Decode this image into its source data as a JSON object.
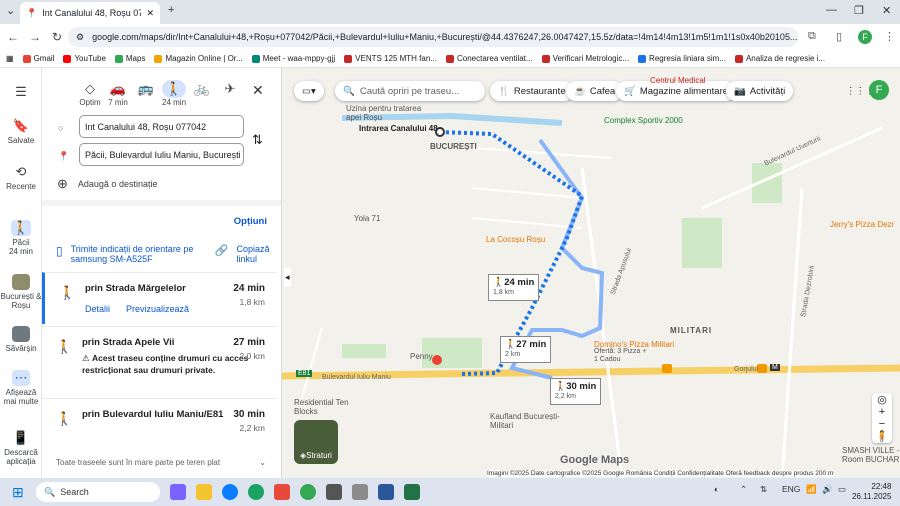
{
  "browser": {
    "tab_title": "Int Canalului 48, Roșu 077042 c",
    "new_tab": "+",
    "url": "google.com/maps/dir/Int+Canalului+48,+Roșu+077042/Păcii,+Bulevardul+Iuliu+Maniu,+București/@44.4376247,26.0047427,15.5z/data=!4m14!4m13!1m5!1m1!1s0x40b20105...",
    "profile_initial": "F",
    "bookmarks": [
      {
        "label": "Gmail",
        "color": "#ea4335"
      },
      {
        "label": "YouTube",
        "color": "#ff0000"
      },
      {
        "label": "Maps",
        "color": "#34a853"
      },
      {
        "label": "Magazin Online | Or...",
        "color": "#f4a300"
      },
      {
        "label": "Meet - waa-mppy-gjj",
        "color": "#00897b"
      },
      {
        "label": "VENTS 125 MTH fan...",
        "color": "#c62828"
      },
      {
        "label": "Conectarea ventilat...",
        "color": "#c62828"
      },
      {
        "label": "Verificari Metrologic...",
        "color": "#c62828"
      },
      {
        "label": "Regresia liniara sim...",
        "color": "#1a73e8"
      },
      {
        "label": "Analiza de regresie i...",
        "color": "#c62828"
      }
    ]
  },
  "rail": {
    "menu": "☰",
    "saved": "Salvate",
    "recent": "Recente",
    "paci": "Păcii",
    "paci_time": "24 min",
    "bucuresti": "București & Roșu",
    "savarsin": "Săvârșin",
    "more": "Afișează mai multe",
    "download": "Descarcă aplicația"
  },
  "panel": {
    "modes": [
      {
        "icon": "◇",
        "label": "Optim"
      },
      {
        "icon": "🚗",
        "label": "7 min"
      },
      {
        "icon": "🚌",
        "label": ""
      },
      {
        "icon": "🚶",
        "label": "24 min"
      },
      {
        "icon": "🚲",
        "label": ""
      },
      {
        "icon": "✈",
        "label": ""
      }
    ],
    "origin": "Int Canalului 48, Roșu 077042",
    "destination": "Păcii, Bulevardul Iuliu Maniu, București",
    "add_destination": "Adaugă o destinație",
    "options": "Opțiuni",
    "send_to_phone": "Trimite indicații de orientare pe samsung SM-A525F",
    "copy_link": "Copiază linkul",
    "routes": [
      {
        "name": "prin Strada Mărgelelor",
        "duration": "24 min",
        "distance": "1,8 km",
        "details": "Detalii",
        "preview": "Previzualizează"
      },
      {
        "name": "prin Strada Apele Vii",
        "duration": "27 min",
        "distance": "2,0 km",
        "warning": "Acest traseu conține drumuri cu acces restricționat sau drumuri private."
      },
      {
        "name": "prin Bulevardul Iuliu Maniu/E81",
        "duration": "30 min",
        "distance": "2,2 km"
      }
    ],
    "footer": "Toate traseele sunt în mare parte pe teren plat"
  },
  "map": {
    "search_placeholder": "Caută opriri pe traseu...",
    "chips": [
      "Restaurante",
      "Cafea",
      "Magazine alimentare",
      "Activități"
    ],
    "labels": {
      "intrarea": "Intrarea Canalului 48",
      "bucuresti": "BUCUREȘTI",
      "uzina": "Uzina pentru tratarea apei Roșu",
      "complex": "Complex Sportiv 2000",
      "cocosu": "La Cocoșu Roșu",
      "yola": "Yola 71",
      "centrul": "Centrul Medical",
      "jerry": "Jerry's Pizza Dezr",
      "militari": "MILITARI",
      "dominos": "Domino's Pizza Militari",
      "dominos_sub": "Ofertă: 3 Pizza + 1 Cadou",
      "penny": "Penny",
      "residential": "Residential Ten Blocks",
      "kaufland": "Kaufland București-Militari",
      "smash": "SMASH VILLE - Room BUCHAR",
      "bulevard": "Bulevardul Iuliu Maniu",
      "gorjului": "Gorjului",
      "apusului": "Strada Apusului",
      "dezrobirii": "Strada Dezrobirii",
      "uverturii": "Bulevardul Uverturii",
      "e81": "E81",
      "gorjului_m": "M"
    },
    "route_boxes": [
      {
        "duration": "24 min",
        "distance": "1,8 km"
      },
      {
        "duration": "27 min",
        "distance": "2 km"
      },
      {
        "duration": "30 min",
        "distance": "2,2 km"
      }
    ],
    "layers_label": "Straturi",
    "logo": "Google Maps",
    "attribution": "Imagini ©2025 Date cartografice ©2025 Google   România   Condiții   Confidențialitate   Oferă feedback despre produs   200 m",
    "route_color": "#1a73e8",
    "alt_route_color": "#8ab4f8"
  },
  "taskbar": {
    "search": "Search",
    "lang": "ENG",
    "time": "22:48",
    "date": "26.11.2025"
  }
}
